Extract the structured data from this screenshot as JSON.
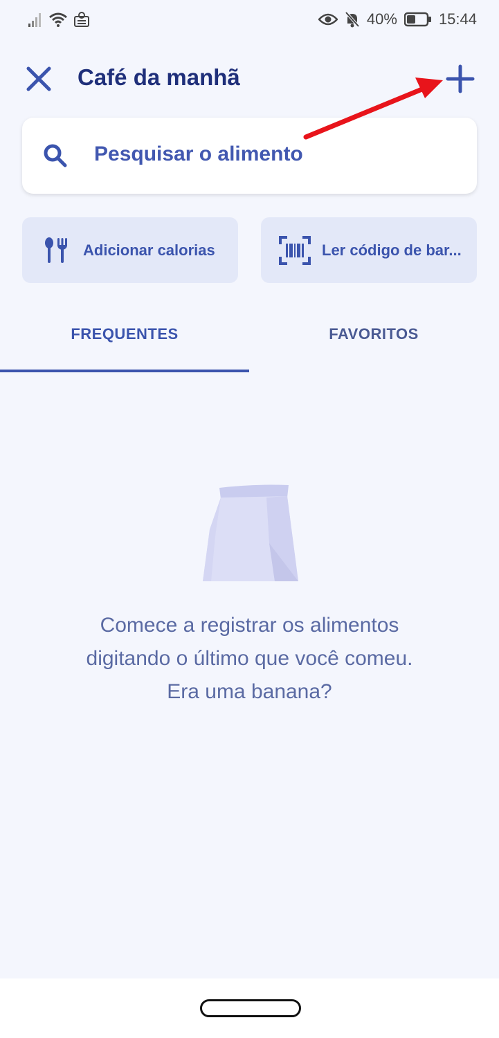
{
  "status_bar": {
    "battery": "40%",
    "time": "15:44"
  },
  "header": {
    "title": "Café da manhã"
  },
  "search": {
    "placeholder": "Pesquisar o alimento"
  },
  "quick_actions": {
    "add_calories": "Adicionar calorias",
    "scan_barcode": "Ler código de bar..."
  },
  "tabs": [
    {
      "label": "FREQUENTES",
      "selected": true
    },
    {
      "label": "FAVORITOS",
      "selected": false
    }
  ],
  "empty_state": {
    "line1": "Comece a registrar os alimentos",
    "line2": "digitando o último que você comeu.",
    "line3": "Era uma banana?"
  },
  "colors": {
    "accent": "#3b54ad",
    "title": "#1f2f7a",
    "background": "#f4f6fd",
    "annotation": "#e8141b"
  },
  "icons": [
    "signal-icon",
    "wifi-icon",
    "notification-icon",
    "eye-icon",
    "bell-off-icon",
    "battery-icon",
    "close-icon",
    "plus-icon",
    "search-icon",
    "cutlery-icon",
    "barcode-icon",
    "paper-bag-illustration"
  ]
}
